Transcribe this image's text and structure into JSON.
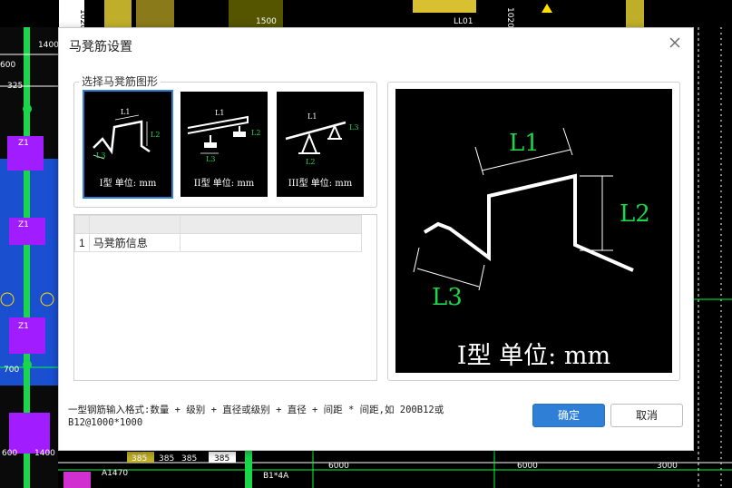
{
  "background": {
    "dims_top": [
      "1020",
      "1400",
      "1020",
      "1500"
    ],
    "labels_left": [
      "600",
      "1400",
      "325",
      "Z1",
      "Z1",
      "Z1",
      "700",
      "600",
      "1400"
    ],
    "dims_bottom": [
      "385",
      "385",
      "385",
      "385",
      "6000",
      "6000",
      "3000"
    ],
    "tags": [
      "LL01",
      "A1470",
      "B1*4A"
    ]
  },
  "dialog": {
    "title": "马凳筋设置",
    "group_label": "选择马凳筋图形",
    "shapes": [
      {
        "caption": "I型  单位: mm",
        "selected": true
      },
      {
        "caption": "II型  单位: mm",
        "selected": false
      },
      {
        "caption": "III型  单位: mm",
        "selected": false
      }
    ],
    "shape_labels": {
      "l1": "L1",
      "l2": "L2",
      "l3": "L3"
    },
    "grid": {
      "rows": [
        {
          "num": "1",
          "name": "马凳筋信息",
          "value": ""
        }
      ]
    },
    "preview": {
      "caption": "I型  单位: mm",
      "l1": "L1",
      "l2": "L2",
      "l3": "L3"
    },
    "hint": "一型钢筋输入格式:数量 + 级别 + 直径或级别 + 直径 + 间距 * 间距,如 200B12或 B12@1000*1000",
    "ok_label": "确定",
    "cancel_label": "取消"
  },
  "colors": {
    "accent": "#2f7fd6",
    "cad_green": "#00ff3a",
    "cad_yellow": "#ffe000"
  }
}
